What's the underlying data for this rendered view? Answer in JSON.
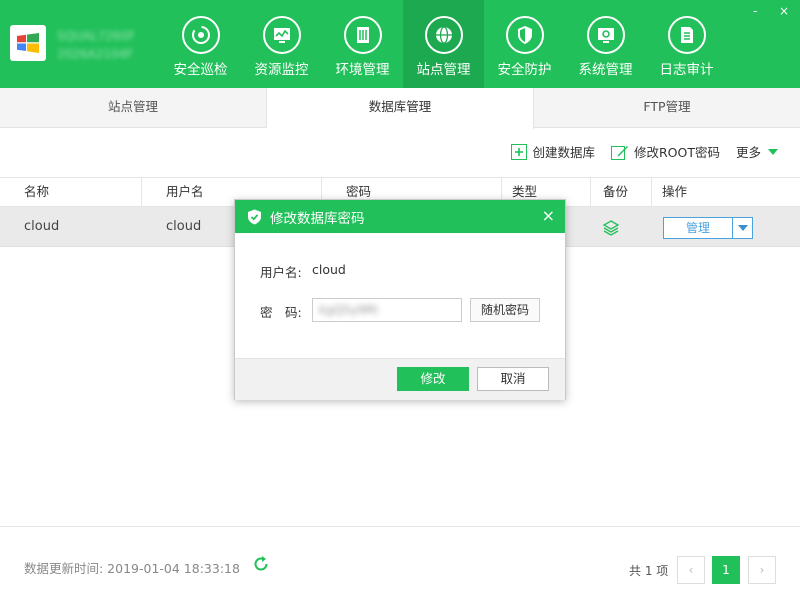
{
  "app": {
    "name_line1": "SQUAL7260F",
    "name_line2": "2026A2104F",
    "accent": "#21c05a",
    "window_controls": [
      "-",
      "×"
    ]
  },
  "nav": [
    {
      "label": "安全巡检",
      "icon": "scan-icon"
    },
    {
      "label": "资源监控",
      "icon": "monitor-icon"
    },
    {
      "label": "环境管理",
      "icon": "server-icon"
    },
    {
      "label": "站点管理",
      "icon": "globe-icon",
      "active": true
    },
    {
      "label": "安全防护",
      "icon": "shield-icon"
    },
    {
      "label": "系统管理",
      "icon": "settings-icon"
    },
    {
      "label": "日志审计",
      "icon": "log-icon"
    }
  ],
  "subtabs": [
    {
      "label": "站点管理"
    },
    {
      "label": "数据库管理",
      "active": true
    },
    {
      "label": "FTP管理"
    }
  ],
  "toolbar": {
    "create_db": "创建数据库",
    "edit_root": "修改ROOT密码",
    "more": "更多"
  },
  "table": {
    "headers": [
      "名称",
      "用户名",
      "密码",
      "类型",
      "备份",
      "操作"
    ],
    "rows": [
      {
        "name": "cloud",
        "username": "cloud",
        "action": "管理"
      }
    ]
  },
  "footer": {
    "update_time": "数据更新时间: 2019-01-04 18:33:18",
    "total": "共 1 项",
    "current_page": "1",
    "prev": "‹",
    "next": "›"
  },
  "modal": {
    "title": "修改数据库密码",
    "close": "×",
    "username_label": "用户名:",
    "username_value": "cloud",
    "password_label": "密　码:",
    "password_value": "kgQ5y9Rt",
    "random_btn": "随机密码",
    "ok": "修改",
    "cancel": "取消"
  }
}
